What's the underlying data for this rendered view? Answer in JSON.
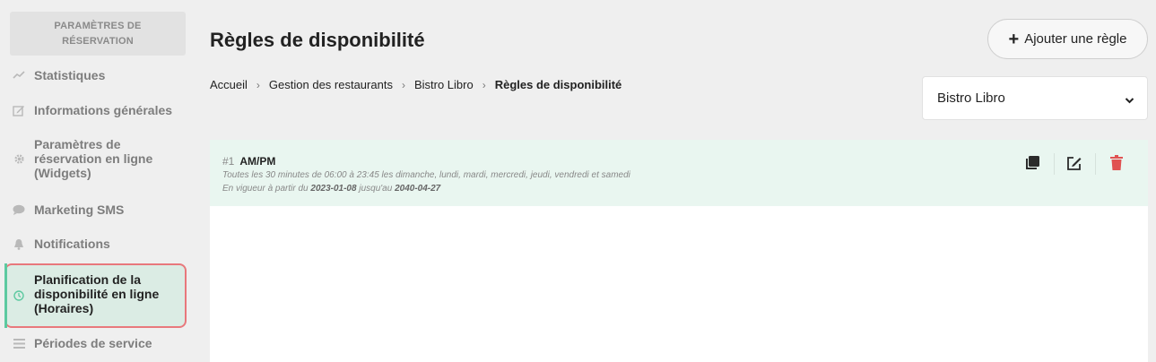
{
  "sidebar": {
    "header": "PARAMÈTRES DE RÉSERVATION",
    "items": [
      {
        "label": "Statistiques",
        "icon": "chart-line-icon"
      },
      {
        "label": "Informations générales",
        "icon": "edit-icon"
      },
      {
        "label": "Paramètres de réservation en ligne (Widgets)",
        "icon": "gear-icon"
      },
      {
        "label": "Marketing SMS",
        "icon": "chat-bubble-icon"
      },
      {
        "label": "Notifications",
        "icon": "bell-icon"
      },
      {
        "label": "Planification de la disponibilité en ligne (Horaires)",
        "icon": "clock-icon",
        "active": true
      },
      {
        "label": "Périodes de service",
        "icon": "list-icon"
      }
    ]
  },
  "header": {
    "title": "Règles de disponibilité",
    "add_button": "Ajouter une règle"
  },
  "breadcrumb": [
    "Accueil",
    "Gestion des restaurants",
    "Bistro Libro",
    "Règles de disponibilité"
  ],
  "restaurant_select": {
    "value": "Bistro Libro"
  },
  "rules": [
    {
      "number": "#1",
      "name": "AM/PM",
      "description": "Toutes les 30 minutes de 06:00 à 23:45 les dimanche, lundi, mardi, mercredi, jeudi, vendredi et samedi",
      "dates_prefix": "En vigueur à partir du",
      "start": "2023-01-08",
      "dates_mid": "jusqu'au",
      "end": "2040-04-27"
    }
  ],
  "colors": {
    "accent": "#5cc9a0",
    "highlight_border": "#e8787c",
    "delete": "#e05252",
    "row_bg": "#e9f6f0"
  }
}
